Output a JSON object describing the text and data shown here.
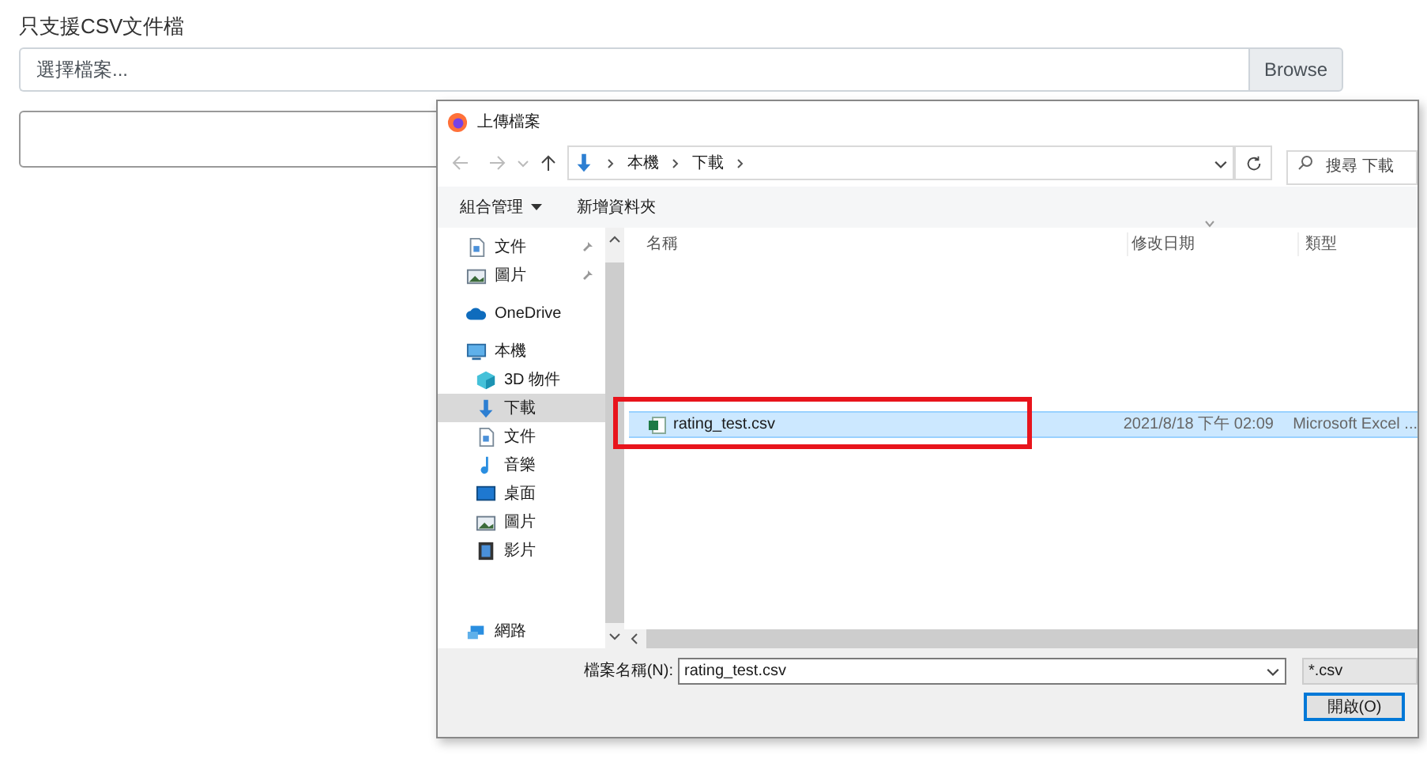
{
  "page": {
    "label": "只支援CSV文件檔",
    "file_input": {
      "placeholder": "選擇檔案...",
      "button": "Browse"
    }
  },
  "dialog": {
    "title": "上傳檔案",
    "address": [
      "本機",
      "下載"
    ],
    "search": {
      "placeholder": "搜尋 下載"
    },
    "toolbar": [
      {
        "label": "組合管理",
        "kind": "menu"
      },
      {
        "label": "新增資料夾",
        "kind": "plain"
      }
    ],
    "sidebar": [
      {
        "label": "文件",
        "kind": "doc",
        "pinned": true,
        "selected": false
      },
      {
        "label": "圖片",
        "kind": "pic",
        "pinned": true,
        "selected": false
      },
      {
        "label": "OneDrive",
        "kind": "cloud",
        "pinned": false,
        "selected": false
      },
      {
        "label": "本機",
        "kind": "pc",
        "pinned": false,
        "selected": false,
        "children": [
          {
            "label": "3D 物件",
            "kind": "cube",
            "pinned": false,
            "selected": false
          },
          {
            "label": "下載",
            "kind": "download",
            "pinned": false,
            "selected": true
          },
          {
            "label": "文件",
            "kind": "doc",
            "pinned": false,
            "selected": false
          },
          {
            "label": "音樂",
            "kind": "music",
            "pinned": false,
            "selected": false
          },
          {
            "label": "桌面",
            "kind": "desktop",
            "pinned": false,
            "selected": false
          },
          {
            "label": "圖片",
            "kind": "pic",
            "pinned": false,
            "selected": false
          },
          {
            "label": "影片",
            "kind": "video",
            "pinned": false,
            "selected": false
          }
        ]
      },
      {
        "label": "網路",
        "kind": "network",
        "pinned": false,
        "selected": false
      }
    ],
    "columns": [
      "名稱",
      "修改日期",
      "類型"
    ],
    "files": [
      {
        "name": "rating_test.csv",
        "date": "2021/8/18 下午 02:09",
        "type": "Microsoft Excel ...",
        "selected": true,
        "highlighted": true
      }
    ],
    "filename_label": "檔案名稱(N):",
    "filename": "rating_test.csv",
    "filter": "*.csv",
    "open_button": "開啟(O)"
  }
}
